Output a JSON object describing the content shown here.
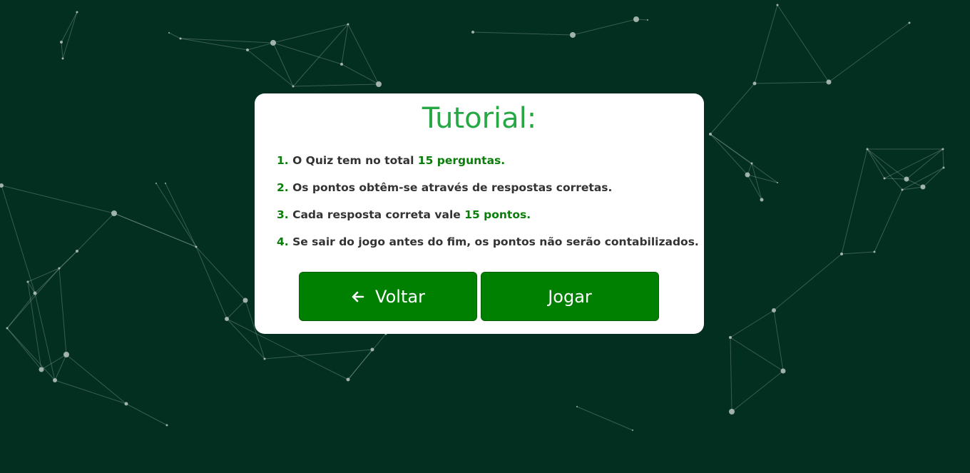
{
  "tutorial": {
    "title": "Tutorial:",
    "rules": [
      {
        "number": "1.",
        "text_before": "O Quiz tem no total ",
        "highlight": "15 perguntas.",
        "text_after": ""
      },
      {
        "number": "2.",
        "text_before": "Os pontos obtêm-se através de respostas corretas.",
        "highlight": "",
        "text_after": ""
      },
      {
        "number": "3.",
        "text_before": "Cada resposta correta vale ",
        "highlight": "15 pontos.",
        "text_after": ""
      },
      {
        "number": "4.",
        "text_before": "Se sair do jogo antes do fim, os pontos não serão contabilizados.",
        "highlight": "",
        "text_after": ""
      }
    ],
    "back_button": {
      "label": "Voltar",
      "icon": "arrow-left-icon"
    },
    "play_button": {
      "label": "Jogar"
    }
  },
  "colors": {
    "background": "#022f1f",
    "title": "#28a745",
    "highlight": "#0a7d0a",
    "button": "#008000"
  }
}
